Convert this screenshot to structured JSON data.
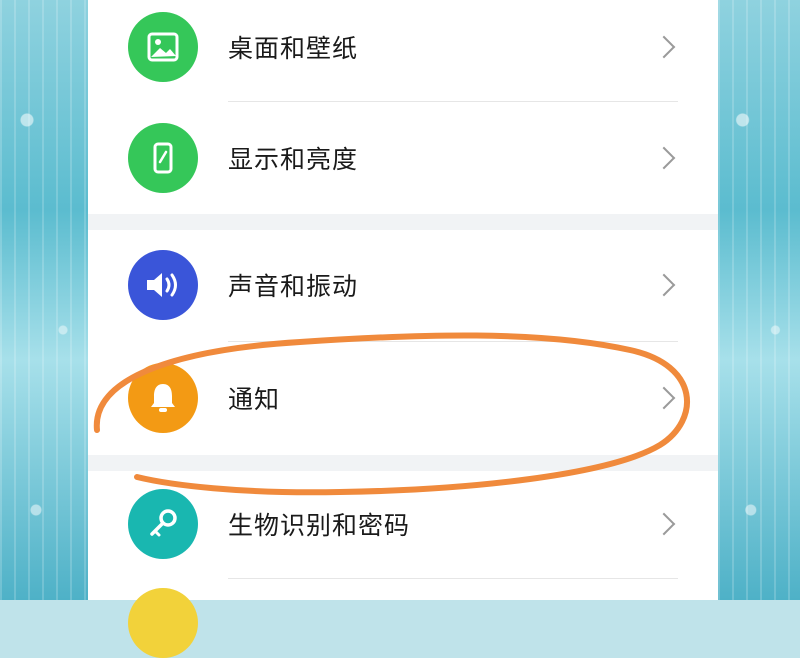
{
  "settings": {
    "items": [
      {
        "label": "桌面和壁纸",
        "icon": "wallpaper-icon",
        "icon_color": "#35c759"
      },
      {
        "label": "显示和亮度",
        "icon": "display-icon",
        "icon_color": "#35c759"
      },
      {
        "label": "声音和振动",
        "icon": "speaker-icon",
        "icon_color": "#3a55d9"
      },
      {
        "label": "通知",
        "icon": "bell-icon",
        "icon_color": "#f39a14"
      },
      {
        "label": "生物识别和密码",
        "icon": "key-icon",
        "icon_color": "#19b7b0"
      }
    ]
  },
  "annotation": {
    "circle_color": "#f08a3c",
    "highlighted_item": "通知"
  }
}
